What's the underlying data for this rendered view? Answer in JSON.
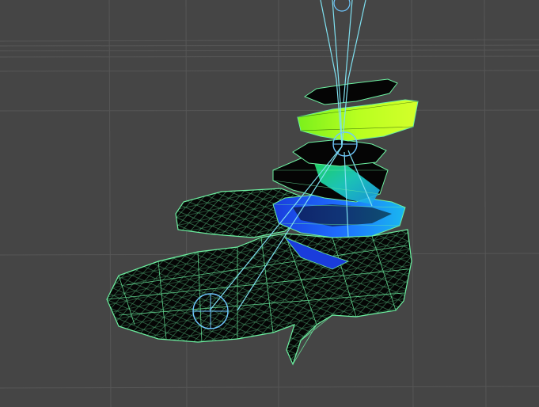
{
  "viewport": {
    "background": "#454545",
    "grid_color": "#5a5a5a",
    "wire_color": "#6cf0a0",
    "bone_color": "#7fe0f0",
    "mesh_fill": "#050505"
  },
  "scene": {
    "object": "wireframe-foot-mesh",
    "weight_colors": [
      "#b4ff1e",
      "#27f0a8",
      "#1f6cff",
      "#1740e0"
    ]
  }
}
